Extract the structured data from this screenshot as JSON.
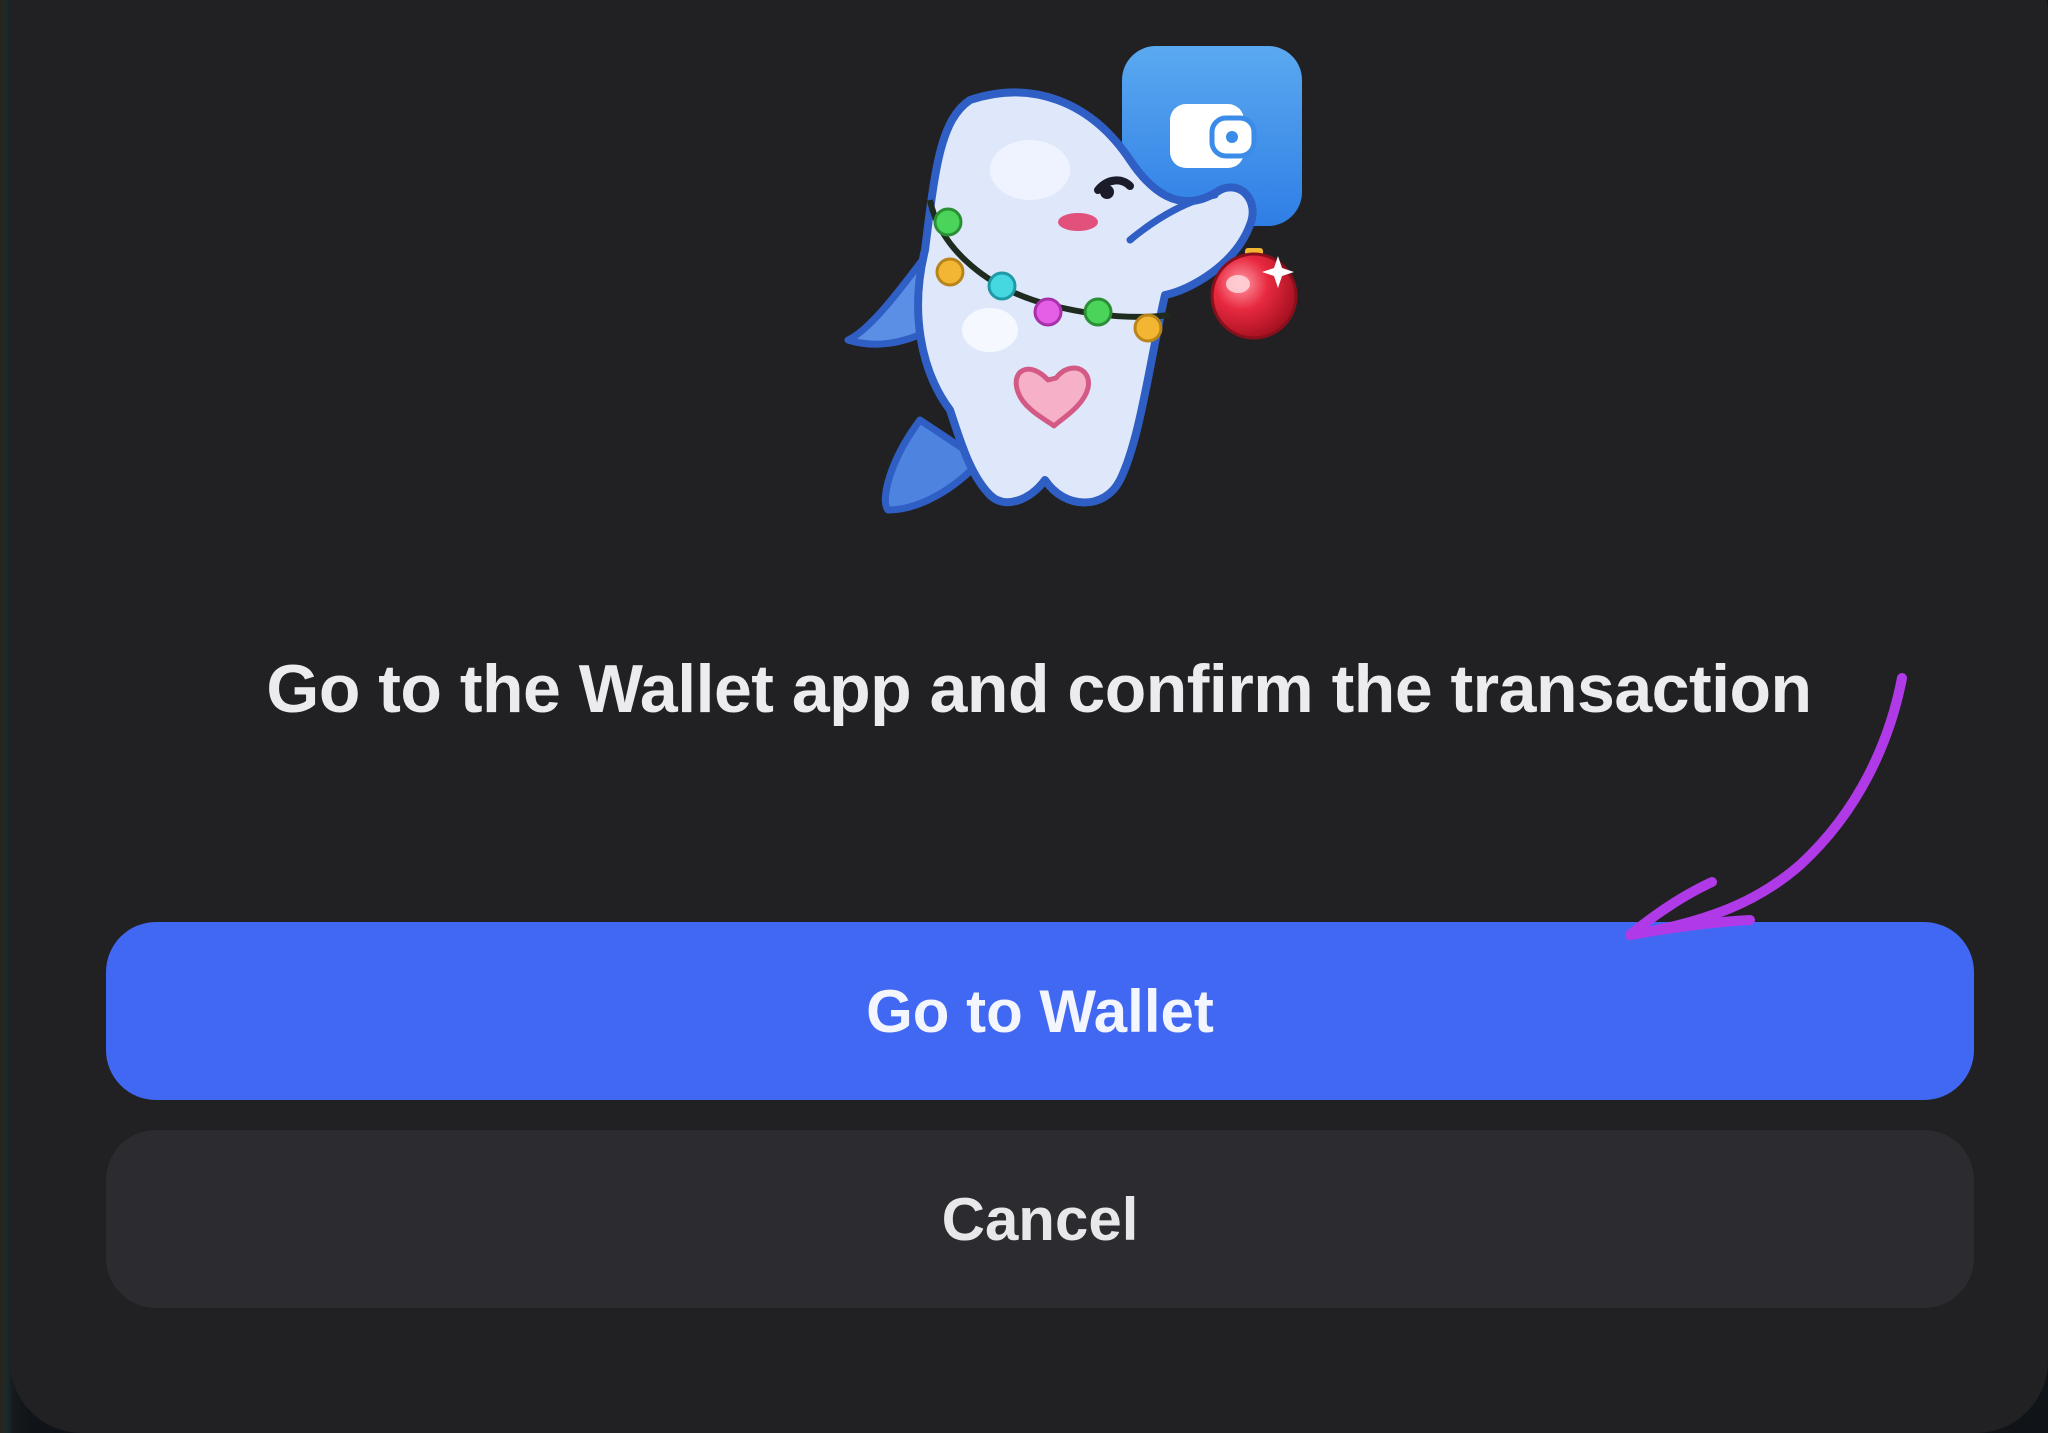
{
  "dialog": {
    "message": "Go to the Wallet app and confirm the transaction",
    "primary_button_label": "Go to Wallet",
    "secondary_button_label": "Cancel"
  },
  "illustration": {
    "icon": "whale-mascot-holding-wallet-icon",
    "badge_icon": "wallet-app-icon",
    "ornament_icon": "christmas-ornament-icon"
  },
  "annotation": {
    "icon": "curved-arrow-icon",
    "color": "#b13ae8"
  },
  "colors": {
    "accent": "#4168f2",
    "dialog_bg": "#212124",
    "secondary_button_bg": "#2c2c30"
  }
}
